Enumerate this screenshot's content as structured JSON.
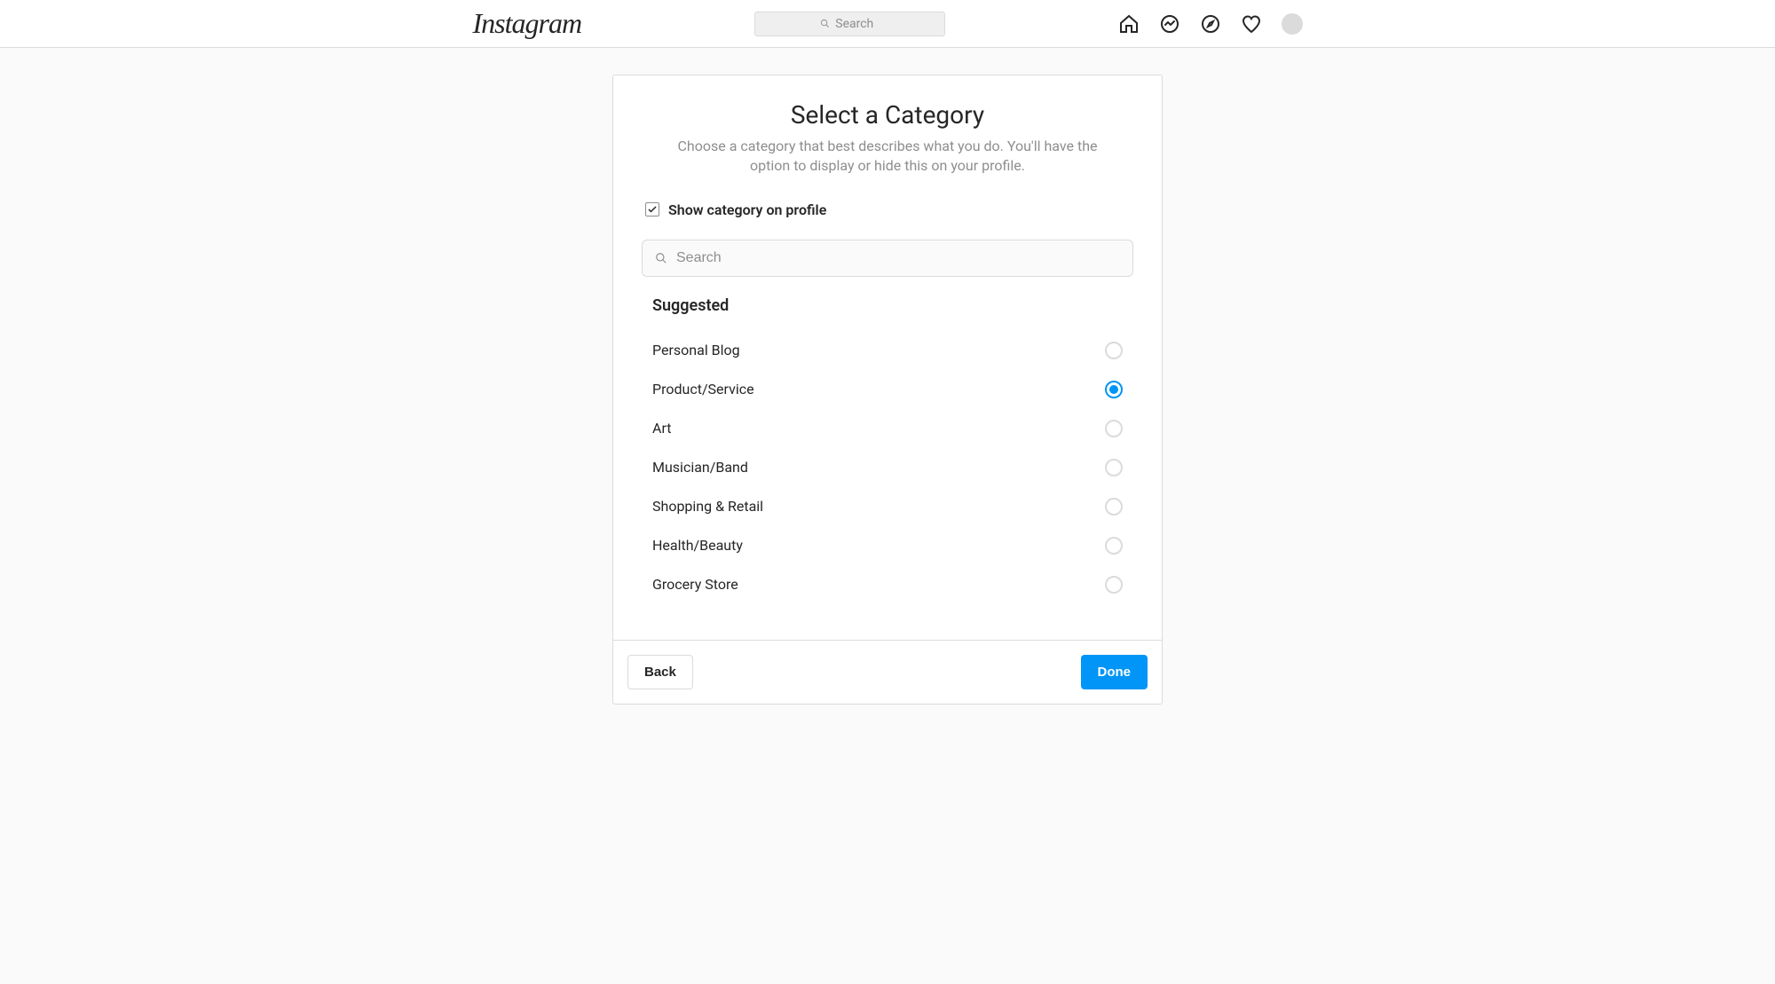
{
  "header": {
    "logo_text": "Instagram",
    "search_placeholder": "Search"
  },
  "card": {
    "title": "Select a Category",
    "subtitle": "Choose a category that best describes what you do. You'll have the option to display or hide this on your profile.",
    "show_checkbox_label": "Show category on profile",
    "show_checkbox_checked": true,
    "search_placeholder": "Search",
    "suggested_title": "Suggested",
    "categories": [
      {
        "label": "Personal Blog",
        "selected": false
      },
      {
        "label": "Product/Service",
        "selected": true
      },
      {
        "label": "Art",
        "selected": false
      },
      {
        "label": "Musician/Band",
        "selected": false
      },
      {
        "label": "Shopping & Retail",
        "selected": false
      },
      {
        "label": "Health/Beauty",
        "selected": false
      },
      {
        "label": "Grocery Store",
        "selected": false
      }
    ],
    "back_button": "Back",
    "done_button": "Done"
  }
}
